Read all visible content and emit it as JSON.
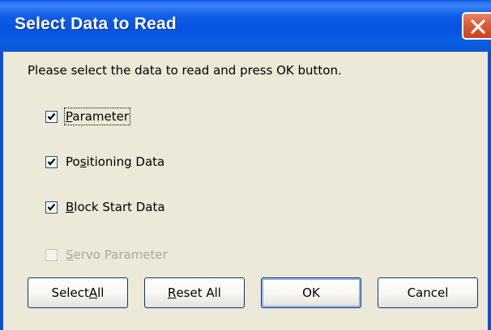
{
  "window": {
    "title": "Select Data to Read",
    "prompt": "Please select the data to read and press OK button."
  },
  "options": [
    {
      "pre": "",
      "key": "P",
      "post": "arameter",
      "checked": true,
      "enabled": true,
      "focused": true
    },
    {
      "pre": "Po",
      "key": "s",
      "post": "itioning Data",
      "checked": true,
      "enabled": true,
      "focused": false
    },
    {
      "pre": "",
      "key": "B",
      "post": "lock Start Data",
      "checked": true,
      "enabled": true,
      "focused": false
    },
    {
      "pre": "",
      "key": "S",
      "post": "ervo Parameter",
      "checked": false,
      "enabled": false,
      "focused": false
    }
  ],
  "buttons": {
    "select_all": {
      "pre": "Select ",
      "key": "A",
      "post": "ll"
    },
    "reset_all": {
      "pre": "",
      "key": "R",
      "post": "eset All"
    },
    "ok": "OK",
    "cancel": "Cancel"
  },
  "icons": {
    "close": "close-icon",
    "check": "checkmark-icon"
  },
  "colors": {
    "titlebar": "#0a58e8",
    "close_button": "#dd5e3b",
    "dialog_bg": "#ece9d8",
    "disabled_text": "#aca899"
  }
}
